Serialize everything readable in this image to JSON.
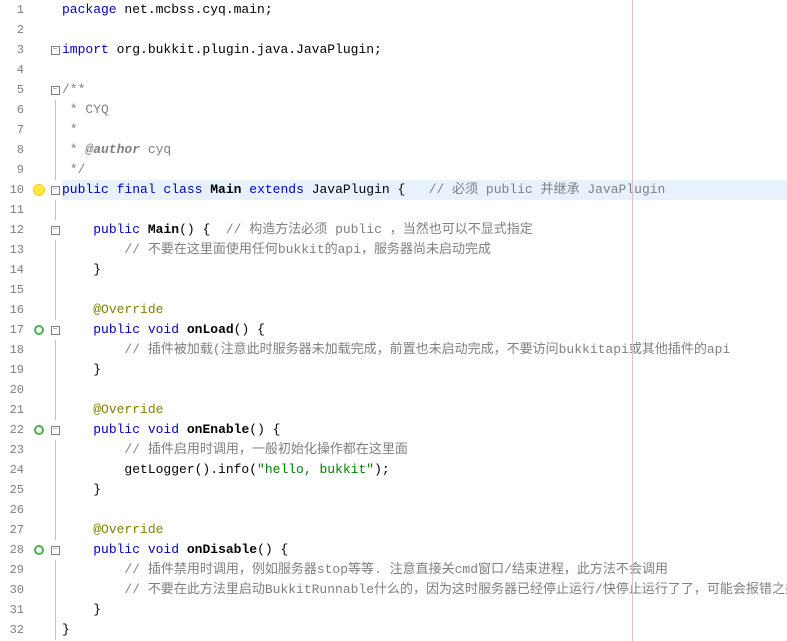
{
  "lines": [
    {
      "num": "1",
      "marker": "",
      "fold": "",
      "text_html": "<span class='kw'>package</span> net.mcbss.cyq.main;"
    },
    {
      "num": "2",
      "marker": "",
      "fold": "",
      "text_html": ""
    },
    {
      "num": "3",
      "marker": "",
      "fold": "box",
      "text_html": "<span class='kw'>import</span> org.bukkit.plugin.java.JavaPlugin;"
    },
    {
      "num": "4",
      "marker": "",
      "fold": "",
      "text_html": ""
    },
    {
      "num": "5",
      "marker": "",
      "fold": "box",
      "text_html": "<span class='doc-comment'>/**</span>"
    },
    {
      "num": "6",
      "marker": "",
      "fold": "line",
      "text_html": "<span class='doc-comment'> * CYQ</span>"
    },
    {
      "num": "7",
      "marker": "",
      "fold": "line",
      "text_html": "<span class='doc-comment'> *</span>"
    },
    {
      "num": "8",
      "marker": "",
      "fold": "line",
      "text_html": "<span class='doc-comment'> * </span><span class='doc-tag'>@author</span><span class='doc-comment'> cyq</span>"
    },
    {
      "num": "9",
      "marker": "",
      "fold": "line",
      "text_html": "<span class='doc-comment'> */</span>"
    },
    {
      "num": "10",
      "marker": "bulb",
      "fold": "box",
      "text_html": "<span class='kw'>public final class</span> <span class='bold'>Main</span> <span class='kw'>extends</span> JavaPlugin {   <span class='comment'>// 必须 public 并继承 JavaPlugin</span>",
      "highlight": true
    },
    {
      "num": "11",
      "marker": "",
      "fold": "line",
      "text_html": ""
    },
    {
      "num": "12",
      "marker": "",
      "fold": "box",
      "text_html": "    <span class='kw'>public</span> <span class='method'>Main</span>() {  <span class='comment'>// 构造方法必须 public ，当然也可以不显式指定</span>"
    },
    {
      "num": "13",
      "marker": "",
      "fold": "line",
      "text_html": "        <span class='comment'>// 不要在这里面使用任何bukkit的api，服务器尚未启动完成</span>"
    },
    {
      "num": "14",
      "marker": "",
      "fold": "line",
      "text_html": "    }"
    },
    {
      "num": "15",
      "marker": "",
      "fold": "line",
      "text_html": ""
    },
    {
      "num": "16",
      "marker": "",
      "fold": "line",
      "text_html": "    <span class='annotation'>@Override</span>"
    },
    {
      "num": "17",
      "marker": "green",
      "fold": "box",
      "text_html": "    <span class='kw'>public void</span> <span class='method'>onLoad</span>() {"
    },
    {
      "num": "18",
      "marker": "",
      "fold": "line",
      "text_html": "        <span class='comment'>// 插件被加载(注意此时服务器未加载完成，前置也未启动完成，不要访问bukkitapi或其他插件的api</span>"
    },
    {
      "num": "19",
      "marker": "",
      "fold": "line",
      "text_html": "    }"
    },
    {
      "num": "20",
      "marker": "",
      "fold": "line",
      "text_html": ""
    },
    {
      "num": "21",
      "marker": "",
      "fold": "line",
      "text_html": "    <span class='annotation'>@Override</span>"
    },
    {
      "num": "22",
      "marker": "green",
      "fold": "box",
      "text_html": "    <span class='kw'>public void</span> <span class='method'>onEnable</span>() {"
    },
    {
      "num": "23",
      "marker": "",
      "fold": "line",
      "text_html": "        <span class='comment'>// 插件启用时调用，一般初始化操作都在这里面</span>"
    },
    {
      "num": "24",
      "marker": "",
      "fold": "line",
      "text_html": "        getLogger().info(<span class='string'>\"hello, bukkit\"</span>);"
    },
    {
      "num": "25",
      "marker": "",
      "fold": "line",
      "text_html": "    }"
    },
    {
      "num": "26",
      "marker": "",
      "fold": "line",
      "text_html": ""
    },
    {
      "num": "27",
      "marker": "",
      "fold": "line",
      "text_html": "    <span class='annotation'>@Override</span>"
    },
    {
      "num": "28",
      "marker": "green",
      "fold": "box",
      "text_html": "    <span class='kw'>public void</span> <span class='method'>onDisable</span>() {"
    },
    {
      "num": "29",
      "marker": "",
      "fold": "line",
      "text_html": "        <span class='comment'>// 插件禁用时调用，例如服务器stop等等. 注意直接关cmd窗口/结束进程，此方法不会调用</span>"
    },
    {
      "num": "30",
      "marker": "",
      "fold": "line",
      "text_html": "        <span class='comment'>// 不要在此方法里启动BukkitRunnable什么的，因为这时服务器已经停止运行/快停止运行了了，可能会报错之类的</span>"
    },
    {
      "num": "31",
      "marker": "",
      "fold": "line",
      "text_html": "    }"
    },
    {
      "num": "32",
      "marker": "",
      "fold": "line",
      "text_html": "}"
    }
  ]
}
